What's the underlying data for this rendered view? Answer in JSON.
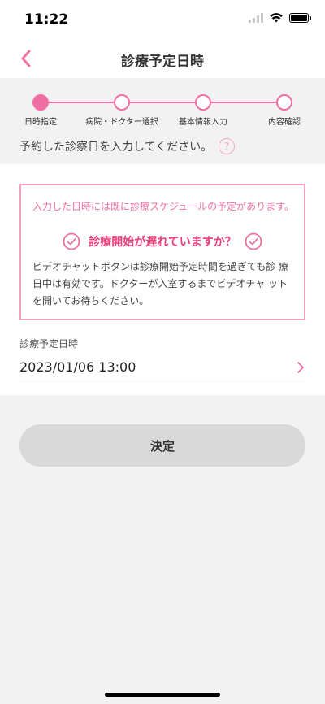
{
  "status_bar": {
    "time": "11:22"
  },
  "nav": {
    "title": "診療予定日時"
  },
  "stepper": {
    "steps": [
      {
        "label": "日時指定",
        "active": true
      },
      {
        "label": "病院・ドクター選択",
        "active": false
      },
      {
        "label": "基本情報入力",
        "active": false
      },
      {
        "label": "内容確認",
        "active": false
      }
    ],
    "instruction": "予約した診察日を入力してください。",
    "help_symbol": "?"
  },
  "alert": {
    "warning": "入力した日時には既に診療スケジュールの予定があります。",
    "question": "診療開始が遅れていますか？",
    "body": "ビデオチャットボタンは診療開始予定時間を過ぎても診 療日中は有効です。ドクターが入室するまでビデオチャ ットを開いてお待ちください。"
  },
  "form": {
    "field_label": "診療予定日時",
    "date_value": "2023/01/06 13:00"
  },
  "actions": {
    "confirm_label": "決定"
  },
  "colors": {
    "accent": "#f06fa3",
    "alert_border": "#f5a0c3",
    "question_text": "#ea3f78",
    "button_bg": "#d9d9d9",
    "background": "#f2f2f2"
  }
}
